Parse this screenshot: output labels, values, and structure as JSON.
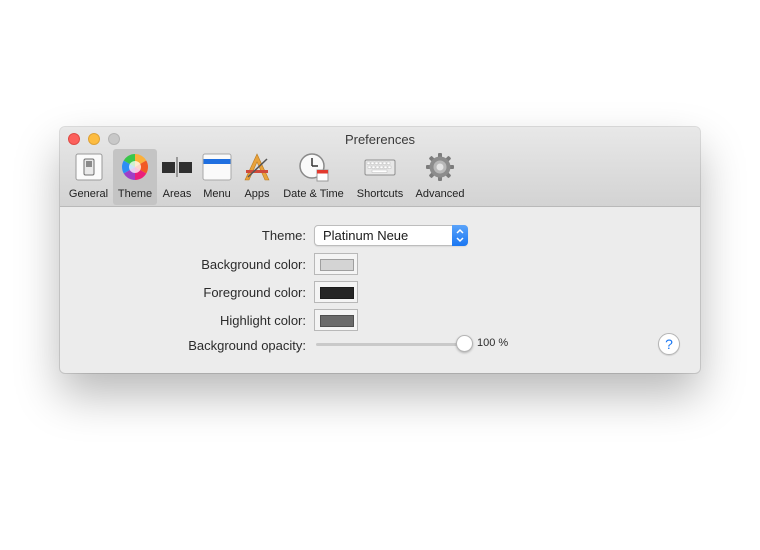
{
  "window": {
    "title": "Preferences"
  },
  "toolbar": {
    "items": [
      {
        "label": "General",
        "icon": "general-switch-icon"
      },
      {
        "label": "Theme",
        "icon": "color-wheel-icon",
        "selected": true
      },
      {
        "label": "Areas",
        "icon": "areas-icon"
      },
      {
        "label": "Menu",
        "icon": "menu-bar-icon"
      },
      {
        "label": "Apps",
        "icon": "apps-icon"
      },
      {
        "label": "Date & Time",
        "icon": "clock-calendar-icon"
      },
      {
        "label": "Shortcuts",
        "icon": "keyboard-icon"
      },
      {
        "label": "Advanced",
        "icon": "gear-icon"
      }
    ]
  },
  "theme_pane": {
    "theme_label": "Theme:",
    "theme_value": "Platinum Neue",
    "background_color_label": "Background color:",
    "background_color_value": "#d4d4d4",
    "foreground_color_label": "Foreground color:",
    "foreground_color_value": "#262626",
    "highlight_color_label": "Highlight color:",
    "highlight_color_value": "#6a6a6a",
    "opacity_label": "Background opacity:",
    "opacity_value": "100 %",
    "opacity_fraction": 1.0,
    "help_label": "?"
  },
  "colors": {
    "accent": "#1a77f2",
    "close": "#fc605c",
    "minimize": "#fdbc40",
    "zoom_inactive": "#c8c8c8"
  }
}
